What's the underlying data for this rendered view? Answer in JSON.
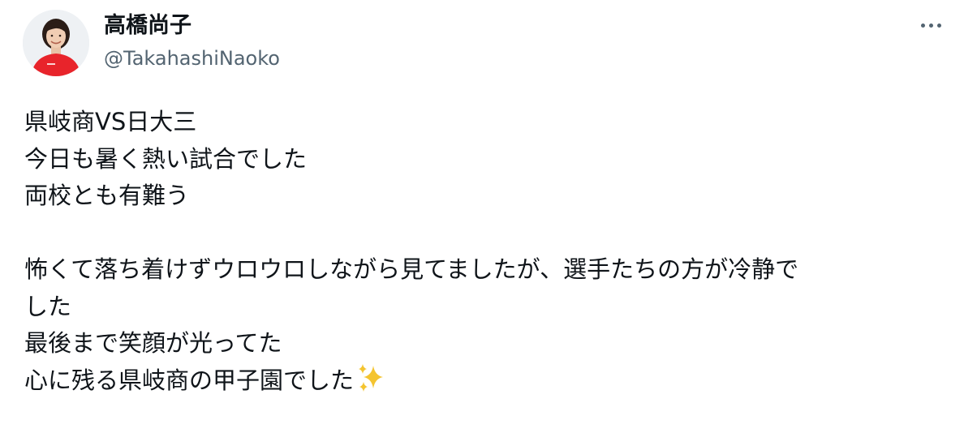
{
  "author": {
    "display_name": "高橋尚子",
    "handle": "@TakahashiNaoko",
    "avatar_icon": "profile-photo-icon"
  },
  "menu": {
    "more_icon": "more-options-icon"
  },
  "post": {
    "lines": [
      "県岐商VS日大三",
      "今日も暑く熱い試合でした",
      "両校とも有難う",
      "",
      "怖くて落ち着けずウロウロしながら見てましたが、選手たちの方が冷静で",
      "した",
      "最後まで笑顔が光ってた",
      "心に残る県岐商の甲子園でした"
    ],
    "trailing_emoji_icon": "sparkles-icon"
  },
  "colors": {
    "text": "#0f1419",
    "secondary": "#536471",
    "background": "#ffffff",
    "sparkle": "#f4c430"
  }
}
